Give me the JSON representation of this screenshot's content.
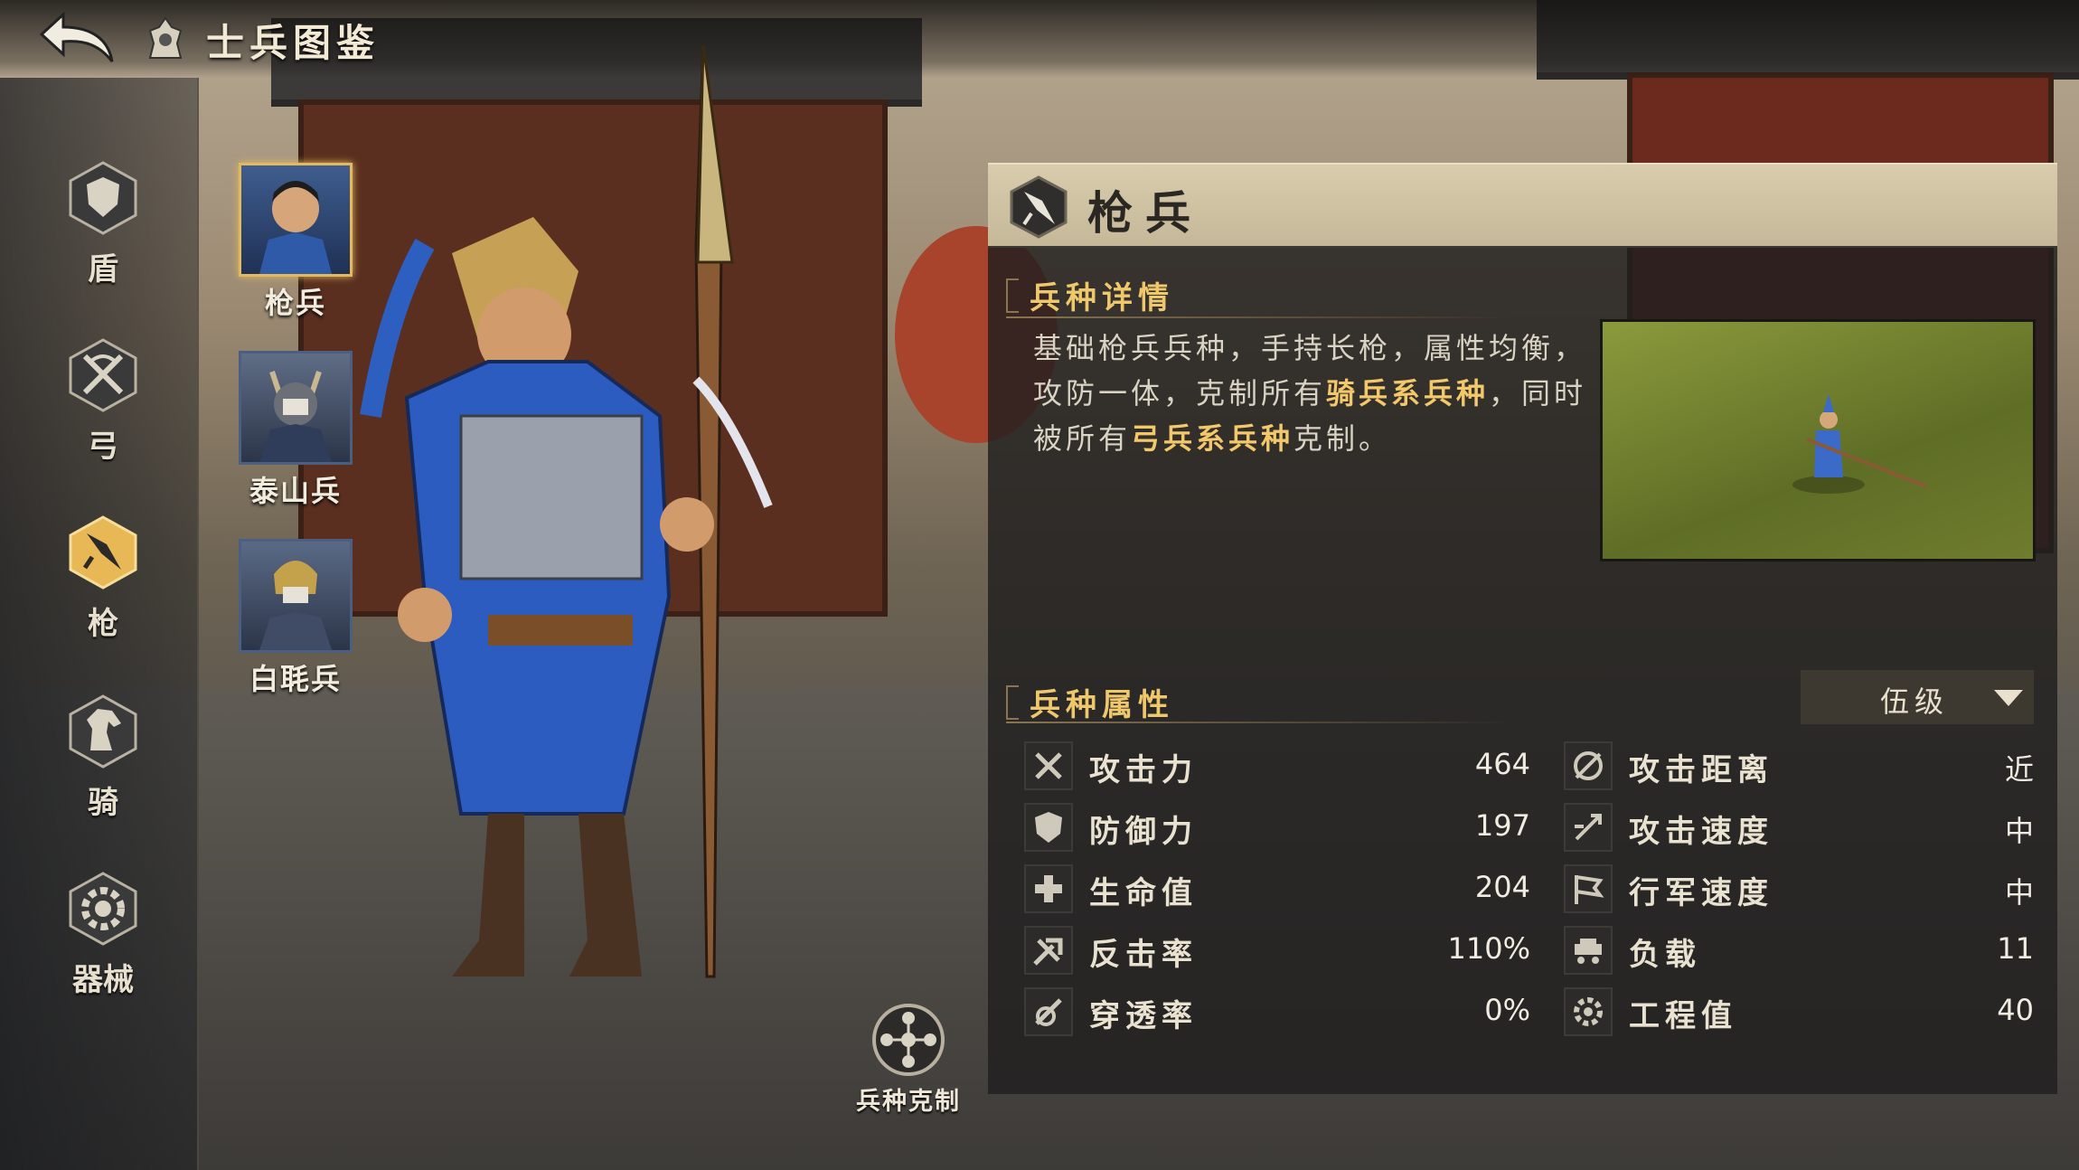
{
  "header": {
    "title": "士兵图鉴"
  },
  "categories": [
    {
      "label": "盾",
      "icon": "shield-icon"
    },
    {
      "label": "弓",
      "icon": "crossed-bow-icon"
    },
    {
      "label": "枪",
      "icon": "spear-icon",
      "selected": true
    },
    {
      "label": "骑",
      "icon": "horse-icon"
    },
    {
      "label": "器械",
      "icon": "gear-icon"
    }
  ],
  "units": [
    {
      "name": "枪兵",
      "selected": true
    },
    {
      "name": "泰山兵"
    },
    {
      "name": "白毦兵"
    }
  ],
  "counter_button": {
    "label": "兵种克制"
  },
  "panel": {
    "unit_name": "枪兵",
    "details_title": "兵种详情",
    "description": {
      "p1": "基础枪兵兵种，手持长枪，属性均衡，攻防一体，克制所有",
      "h1": "骑兵系兵种",
      "p2": "，同时被所有",
      "h2": "弓兵系兵种",
      "p3": "克制。"
    },
    "attributes_title": "兵种属性",
    "level": "伍级",
    "stats_left": [
      {
        "label": "攻击力",
        "value": "464",
        "icon": "crossed-swords-icon"
      },
      {
        "label": "防御力",
        "value": "197",
        "icon": "shield-icon"
      },
      {
        "label": "生命值",
        "value": "204",
        "icon": "health-cross-icon"
      },
      {
        "label": "反击率",
        "value": "110%",
        "icon": "counter-attack-icon"
      },
      {
        "label": "穿透率",
        "value": "0%",
        "icon": "pierce-icon"
      }
    ],
    "stats_right": [
      {
        "label": "攻击距离",
        "value": "近",
        "icon": "range-icon"
      },
      {
        "label": "攻击速度",
        "value": "中",
        "icon": "attack-speed-icon"
      },
      {
        "label": "行军速度",
        "value": "中",
        "icon": "march-flag-icon"
      },
      {
        "label": "负载",
        "value": "11",
        "icon": "load-cart-icon"
      },
      {
        "label": "工程值",
        "value": "40",
        "icon": "engineering-gear-icon"
      }
    ]
  },
  "colors": {
    "accent_gold": "#f0c86c",
    "highlight": "#f3c86a",
    "panel_bg": "#201f1e",
    "header_bg": "#d8ccad"
  }
}
